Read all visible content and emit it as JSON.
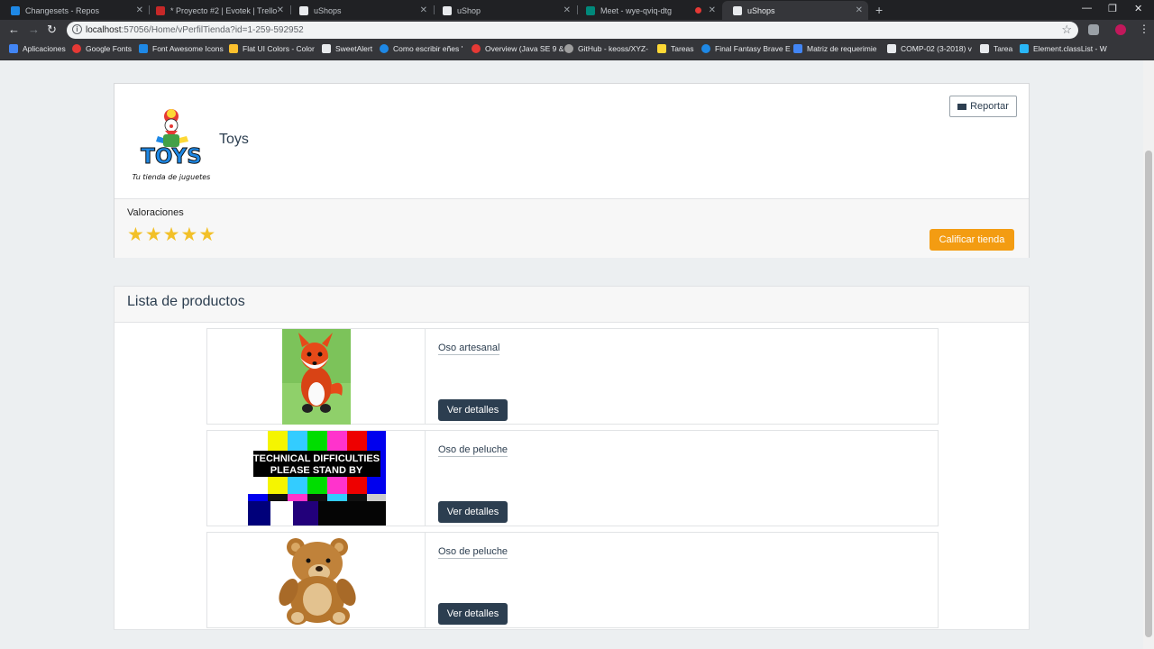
{
  "browser": {
    "tabs": [
      {
        "title": "Changesets - Repos",
        "color": "#1e88e5"
      },
      {
        "title": "* Proyecto #2 | Evotek | Trello",
        "color": "#c62828"
      },
      {
        "title": "uShops",
        "color": "#e8eaed"
      },
      {
        "title": "uShop",
        "color": "#e8eaed"
      },
      {
        "title": "Meet - wye-qviq-dtg",
        "color": "#00897b"
      },
      {
        "title": "uShops",
        "color": "#e8eaed"
      }
    ],
    "address": {
      "host": "localhost",
      "path": ":57056/Home/vPerfilTienda?id=1-259-592952"
    },
    "bookmarks": [
      {
        "label": "Aplicaciones",
        "color": "#4285f4"
      },
      {
        "label": "Google Fonts",
        "color": "#e53935"
      },
      {
        "label": "Font Awesome Icons",
        "color": "#1e88e5"
      },
      {
        "label": "Flat UI Colors - Color",
        "color": "#fbc02d"
      },
      {
        "label": "SweetAlert",
        "color": "#e8eaed"
      },
      {
        "label": "Como escribir eñes '",
        "color": "#1e88e5"
      },
      {
        "label": "Overview (Java SE 9 &",
        "color": "#e53935"
      },
      {
        "label": "GitHub - keoss/XYZ-",
        "color": "#9e9e9e"
      },
      {
        "label": "Tareas",
        "color": "#fdd835"
      },
      {
        "label": "Final Fantasy Brave E",
        "color": "#1e88e5"
      },
      {
        "label": "Matriz de requerimie",
        "color": "#4285f4"
      },
      {
        "label": "COMP-02 (3-2018) v",
        "color": "#e8eaed"
      },
      {
        "label": "Tarea",
        "color": "#e8eaed"
      },
      {
        "label": "Element.classList - W",
        "color": "#29b6f6"
      }
    ]
  },
  "store": {
    "logo_text_top": "TOYS",
    "logo_text_bottom": "Tu tienda de juguetes",
    "name": "Toys",
    "report_label": "Reportar",
    "ratings_label": "Valoraciones",
    "rating": 5,
    "rating_max": 5,
    "rate_label": "Calificar tienda",
    "colors": {
      "accent": "#f39c12",
      "primary": "#2c3e50",
      "star": "#f2c028"
    }
  },
  "products": {
    "title": "Lista de productos",
    "items": [
      {
        "name": "Oso artesanal",
        "button": "Ver detalles",
        "image": "red-fox-plush"
      },
      {
        "name": "Oso de peluche",
        "button": "Ver detalles",
        "image": "test-pattern",
        "image_text_1": "TECHNICAL DIFFICULTIES",
        "image_text_2": "PLEASE STAND BY"
      },
      {
        "name": "Oso de peluche",
        "button": "Ver detalles",
        "image": "teddy-bear"
      }
    ]
  }
}
